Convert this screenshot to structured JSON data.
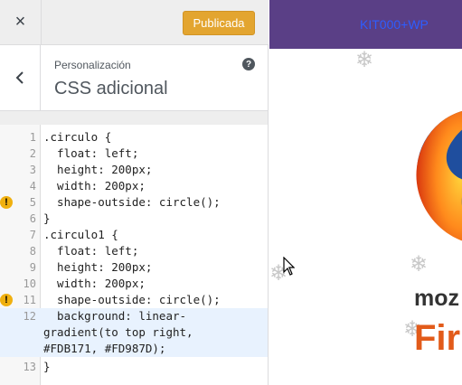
{
  "toolbar": {
    "close_label": "×",
    "publish_label": "Publicada"
  },
  "section": {
    "subtitle": "Personalización",
    "title": "CSS adicional",
    "help": "?"
  },
  "editor": {
    "lines": [
      {
        "n": "1",
        "text": ".circulo {"
      },
      {
        "n": "2",
        "text": "  float: left;"
      },
      {
        "n": "3",
        "text": "  height: 200px;"
      },
      {
        "n": "4",
        "text": "  width: 200px;"
      },
      {
        "n": "5",
        "text": "  shape-outside: circle();"
      },
      {
        "n": "6",
        "text": "}"
      },
      {
        "n": "7",
        "text": ".circulo1 {"
      },
      {
        "n": "8",
        "text": "  float: left;"
      },
      {
        "n": "9",
        "text": "  height: 200px;"
      },
      {
        "n": "10",
        "text": "  width: 200px;"
      },
      {
        "n": "11",
        "text": "  shape-outside: circle();"
      },
      {
        "n": "12",
        "text": "  background: linear-"
      },
      {
        "n": "",
        "text": "gradient(to top right,"
      },
      {
        "n": "",
        "text": "#FDB171, #FD987D);"
      },
      {
        "n": "13",
        "text": "}"
      }
    ],
    "warning_icon": "!"
  },
  "preview": {
    "link_text": "KIT000+WP",
    "moz": "moz",
    "fire": "Fir"
  }
}
